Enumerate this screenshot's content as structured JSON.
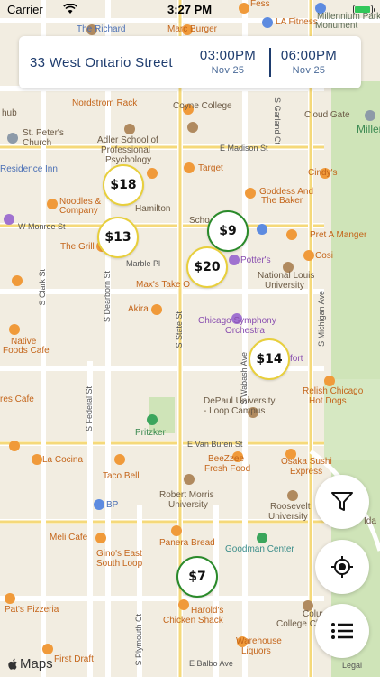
{
  "status_bar": {
    "carrier": "Carrier",
    "time": "3:27 PM"
  },
  "search": {
    "address": "33 West Ontario Street",
    "start": {
      "time": "03:00PM",
      "date": "Nov 25"
    },
    "end": {
      "time": "06:00PM",
      "date": "Nov 25"
    }
  },
  "pins": [
    {
      "price": "$18",
      "status": "yellow"
    },
    {
      "price": "$13",
      "status": "yellow"
    },
    {
      "price": "$9",
      "status": "green"
    },
    {
      "price": "$20",
      "status": "yellow"
    },
    {
      "price": "$14",
      "status": "yellow"
    },
    {
      "price": "$7",
      "status": "green"
    }
  ],
  "controls": {
    "filter_icon": "filter-icon",
    "locate_icon": "location-target-icon",
    "list_icon": "list-icon"
  },
  "map": {
    "attribution": "Maps",
    "legal": "Legal",
    "labels": {
      "fess": "Fess",
      "la_fitness": "LA Fitness",
      "richard": "The Richard",
      "marc_burger": "Marc Burger",
      "millennium_park": "Millennium Park",
      "millennium_monument": "Monument",
      "nordstrom_rack": "Nordstrom Rack",
      "coyne_college": "Coyne College",
      "cloud_gate": "Cloud Gate",
      "miller": "Miller",
      "hub": "hub",
      "st_peters": "St. Peter's",
      "church": "Church",
      "adler_1": "Adler School of",
      "adler_2": "Professional",
      "adler_3": "Psychology",
      "e_madison": "E Madison St",
      "residence_inn": "Residence Inn",
      "target": "Target",
      "cindys": "Cindy's",
      "goddess_1": "Goddess And",
      "goddess_2": "The Baker",
      "noodles_1": "Noodles &",
      "noodles_2": "Company",
      "hamilton": "Hamilton",
      "w_monroe": "W Monroe St",
      "schoo": "Scho",
      "the_grill": "The Grill",
      "potters": "Potter's",
      "pret": "Pret A Manger",
      "marble_pl": "Marble Pl",
      "cosi": "Cosi",
      "maxs": "Max's Take O",
      "national_louis_1": "National Louis",
      "national_louis_2": "University",
      "akira": "Akira",
      "chicago_symphony_1": "Chicago Symphony",
      "chicago_symphony_2": "Orchestra",
      "native_1": "Native",
      "native_2": "Foods Cafe",
      "fort": "fort",
      "relish_1": "Relish Chicago",
      "relish_2": "Hot Dogs",
      "res_cafe": "res Cafe",
      "depaul_1": "DePaul University",
      "depaul_2": "- Loop Campus",
      "pritzker": "Pritzker",
      "van_buren": "E Van Buren St",
      "la_cocina": "La Cocina",
      "beezzee_1": "BeeZzee",
      "beezzee_2": "Fresh Food",
      "osaka_1": "Osaka Sushi",
      "osaka_2": "Express",
      "taco_bell": "Taco Bell",
      "robert_morris_1": "Robert Morris",
      "robert_morris_2": "University",
      "bp": "BP",
      "roosevelt_1": "Roosevelt",
      "roosevelt_2": "University",
      "ida": "Ida",
      "meli": "Meli Cafe",
      "panera": "Panera Bread",
      "ginos_1": "Gino's East",
      "ginos_2": "South Loop",
      "goodman": "Goodman Center",
      "pats": "Pat's Pizzeria",
      "harolds_1": "Harold's",
      "harolds_2": "Chicken Shack",
      "columbia_1": "Columbia",
      "columbia_2": "College Chic",
      "warehouse_1": "Warehouse",
      "warehouse_2": "Liquors",
      "first_draft": "First Draft",
      "e_balbo": "E Balbo Ave",
      "s_clark": "S Clark St",
      "s_dearborn": "S Dearborn St",
      "s_state": "S State St",
      "s_wabash": "S Wabash Ave",
      "s_michigan": "S Michigan Ave",
      "s_federal": "S Federal St",
      "s_plymouth": "S Plymouth Ct",
      "s_garland": "S Garland Ct"
    }
  }
}
